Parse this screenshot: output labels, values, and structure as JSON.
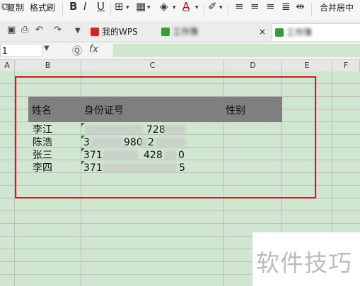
{
  "ribbon": {
    "copy_label": "复制",
    "format_painter_label": "格式刷",
    "merge_label": "合并居中"
  },
  "tabs": {
    "wps_label": "我的WPS",
    "doc1_label": "工作簿",
    "doc2_label": "工作簿",
    "close_glyph": "×"
  },
  "formula_bar": {
    "cell_ref": "1",
    "fx_label": "fx"
  },
  "columns": [
    "A",
    "B",
    "C",
    "D",
    "E",
    "F"
  ],
  "table": {
    "headers": [
      "姓名",
      "身份证号",
      "性别"
    ],
    "rows": [
      {
        "name": "李江",
        "id_visible": "728"
      },
      {
        "name": "陈浩",
        "id_visible": "3",
        "id_mid": "980",
        "id_end": "2"
      },
      {
        "name": "张三",
        "id_visible": "371",
        "id_mid": "428",
        "id_end": "0"
      },
      {
        "name": "李四",
        "id_visible": "371",
        "id_end": "5"
      }
    ]
  },
  "watermark": {
    "text": "软件技巧"
  },
  "colors": {
    "selection_border": "#e0151a",
    "sheet_bg": "#cfe6cf",
    "header_band": "#7f7f7f"
  }
}
